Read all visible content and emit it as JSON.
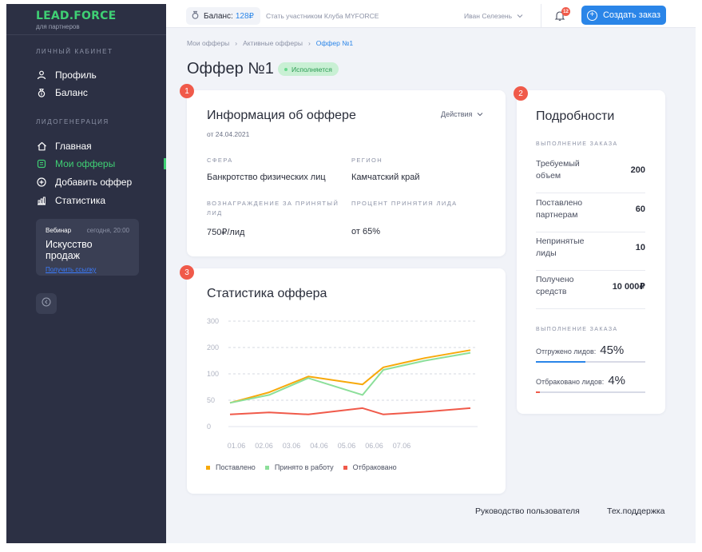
{
  "sidebar": {
    "logo": "LEAD.FORCE",
    "logo_sub": "для партнеров",
    "section_cabinet": "ЛИЧНЫЙ КАБИНЕТ",
    "section_leadgen": "ЛИДОГЕНЕРАЦИЯ",
    "items": [
      {
        "label": "Профиль",
        "icon": "user-icon"
      },
      {
        "label": "Баланс",
        "icon": "money-bag-icon"
      },
      {
        "label": "Главная",
        "icon": "home-icon"
      },
      {
        "label": "Мои офферы",
        "icon": "offers-icon",
        "active": true
      },
      {
        "label": "Добавить оффер",
        "icon": "add-circle-icon"
      },
      {
        "label": "Статистика",
        "icon": "stats-icon"
      }
    ],
    "webinar": {
      "tag": "Вебинар",
      "time": "сегодня, 20:00",
      "title": "Искусство продаж",
      "link": "Получить ссылку"
    }
  },
  "topbar": {
    "balance_label": "Баланс:",
    "balance_value": "128₽",
    "club_text": "Стать участником Клуба MYFORCE",
    "user_name": "Иван Селезень",
    "notifications_count": "12",
    "create_button": "Создать заказ"
  },
  "breadcrumb": [
    "Мои офферы",
    "Активные офферы",
    "Оффер №1"
  ],
  "page": {
    "title": "Оффер №1",
    "status": "Исполняется"
  },
  "info_card": {
    "marker": "1",
    "title": "Информация об оффере",
    "date": "от 24.04.2021",
    "actions_label": "Действия",
    "fields": [
      {
        "label": "СФЕРА",
        "value": "Банкротство физических лиц"
      },
      {
        "label": "РЕГИОН",
        "value": "Камчатский край"
      },
      {
        "label": "ВОЗНАГРАЖДЕНИЕ ЗА ПРИНЯТЫЙ ЛИД",
        "value": "750₽/лид"
      },
      {
        "label": "ПРОЦЕНТ ПРИНЯТИЯ ЛИДА",
        "value": "от 65%"
      }
    ]
  },
  "details_card": {
    "marker": "2",
    "title": "Подробности",
    "section1": "ВЫПОЛНЕНИЕ ЗАКАЗА",
    "rows": [
      {
        "label": "Требуемый объем",
        "value": "200"
      },
      {
        "label": "Поставлено партнерам",
        "value": "60"
      },
      {
        "label": "Непринятые лиды",
        "value": "10"
      },
      {
        "label": "Получено средств",
        "value": "10 000₽"
      }
    ],
    "section2": "ВЫПОЛНЕНИЕ ЗАКАЗА",
    "progress": [
      {
        "label": "Отгружено лидов:",
        "percent": "45%",
        "value": 0.45,
        "color": "#2a85e8"
      },
      {
        "label": "Отбраковано лидов:",
        "percent": "4%",
        "value": 0.04,
        "color": "#f05a4a"
      }
    ]
  },
  "stats_card": {
    "marker": "3",
    "title": "Статистика оффера"
  },
  "chart_data": {
    "type": "line",
    "x": [
      "01.06",
      "02.06",
      "03.06",
      "04.06",
      "05.06",
      "06.06",
      "07.06"
    ],
    "y_ticks": [
      "300",
      "200",
      "100",
      "50",
      "0"
    ],
    "series": [
      {
        "name": "Поставлено",
        "color": "#f7a90b",
        "values": [
          45,
          65,
          95,
          80,
          125,
          160,
          190
        ]
      },
      {
        "name": "Принято в работу",
        "color": "#8cdf9a",
        "values": [
          45,
          60,
          92,
          60,
          115,
          150,
          180
        ]
      },
      {
        "name": "Отбраковано",
        "color": "#f05a4a",
        "values": [
          23,
          27,
          23,
          35,
          23,
          28,
          35
        ]
      }
    ]
  },
  "footer": {
    "guide": "Руководство пользователя",
    "support": "Тех.поддержка"
  }
}
